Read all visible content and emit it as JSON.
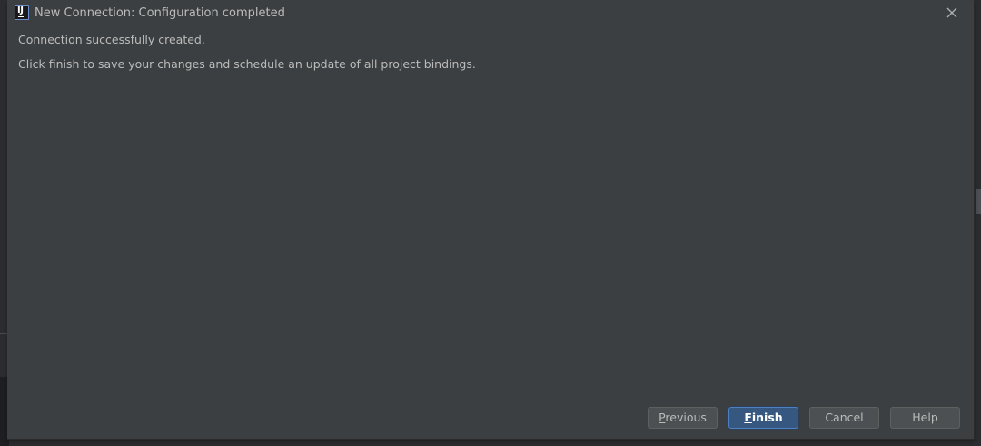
{
  "window": {
    "title": "New Connection: Configuration completed",
    "app_icon": "intellij-idea-icon",
    "close_icon": "close-icon"
  },
  "content": {
    "line1": "Connection successfully created.",
    "line2": "Click finish to save your changes and schedule an update of all project bindings."
  },
  "buttons": {
    "previous": {
      "mnemonic": "P",
      "rest": "revious"
    },
    "finish": {
      "mnemonic": "F",
      "rest": "inish"
    },
    "cancel": "Cancel",
    "help": "Help"
  },
  "colors": {
    "dialog_bg": "#3c3f41",
    "text": "#bbbbbb",
    "default_button_bg": "#365880",
    "button_bg": "#4c5052"
  }
}
